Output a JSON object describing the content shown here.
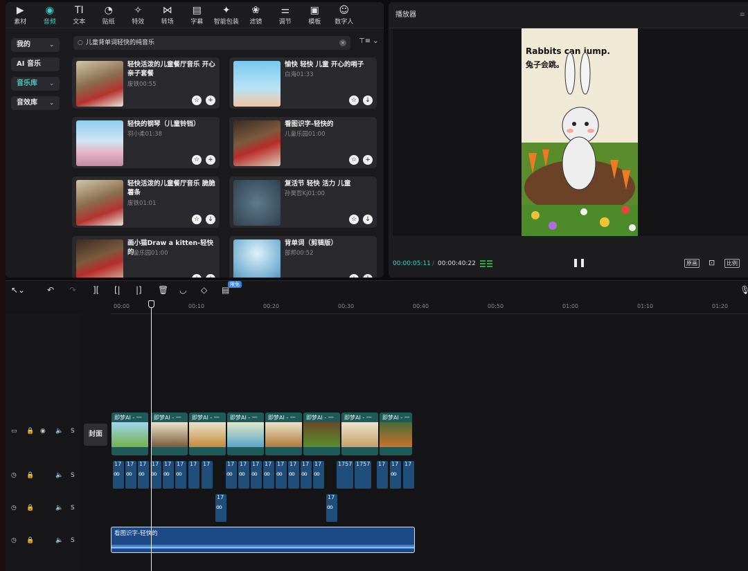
{
  "toolbar": {
    "items": [
      {
        "label": "素材",
        "icon": "media-icon"
      },
      {
        "label": "音频",
        "icon": "audio-icon"
      },
      {
        "label": "文本",
        "icon": "text-icon"
      },
      {
        "label": "贴纸",
        "icon": "sticker-icon"
      },
      {
        "label": "特效",
        "icon": "effects-icon"
      },
      {
        "label": "转场",
        "icon": "transition-icon"
      },
      {
        "label": "字幕",
        "icon": "subtitle-icon"
      },
      {
        "label": "智能包装",
        "icon": "smart-pack-icon"
      },
      {
        "label": "滤镜",
        "icon": "filter-icon"
      },
      {
        "label": "调节",
        "icon": "adjust-icon"
      },
      {
        "label": "模板",
        "icon": "template-icon"
      },
      {
        "label": "数字人",
        "icon": "digital-human-icon"
      }
    ],
    "active": "音频"
  },
  "sidebar": {
    "items": [
      {
        "label": "我的",
        "chevron": "⌄"
      },
      {
        "label": "AI 音乐"
      },
      {
        "label": "音乐库",
        "chevron": "⌄"
      },
      {
        "label": "音效库",
        "chevron": "⌄"
      }
    ],
    "active": "音乐库"
  },
  "search": {
    "value": "儿童背单词轻快的纯音乐",
    "filter_label": "⊤≡ ⌄"
  },
  "cards": [
    {
      "title": "轻快活泼的儿童餐厅音乐 开心亲子套餐",
      "meta": "废铁00:55",
      "action": "+"
    },
    {
      "title": "愉快 轻快 儿童 开心的哨子",
      "meta": "白海01:33",
      "action": "↓"
    },
    {
      "title": "轻快的钢琴（儿童铃铛）",
      "meta": "羽小柔01:38",
      "action": "+"
    },
    {
      "title": "看图识字-轻快的",
      "meta": "儿童乐园01:00",
      "action": "+"
    },
    {
      "title": "轻快活泼的儿童餐厅音乐 脆脆薯条",
      "meta": "废铁01:01",
      "action": "↓"
    },
    {
      "title": "复活节 轻快 活力 儿童",
      "meta": "孙昊哲Kj01:00",
      "action": "↓"
    },
    {
      "title": "画小猫Draw a kitten-轻快的",
      "meta": "儿童乐园01:00",
      "action": "+"
    },
    {
      "title": "背单词（剪辑版）",
      "meta": "部邦00:52",
      "action": "↓"
    }
  ],
  "player": {
    "title": "播放器",
    "video_text_en": "Rabbits can jump.",
    "video_text_zh": "兔子会跳。",
    "current_time": "00:00:05:11",
    "separator": "/",
    "total_time": "00:00:40:22",
    "buttons": {
      "original": "原画",
      "fit": "⊡",
      "ratio": "比例"
    }
  },
  "timeline": {
    "badge": "限免",
    "ruler": [
      "00:00",
      "00:10",
      "00:20",
      "00:30",
      "00:40",
      "00:50",
      "01:00",
      "01:10",
      "01:20"
    ],
    "cover_label": "封面",
    "video_clip_label": "即梦AI - 一",
    "audio_clip_label": "17",
    "audio_clip_label_wide": "1757",
    "music_label": "看图识字-轻快的",
    "track_s": "S"
  },
  "colors": {
    "accent": "#35d0c8",
    "audio_clip": "#1f4e7a",
    "music_clip": "#1b4a86",
    "video_clip": "#1f5a5a"
  }
}
